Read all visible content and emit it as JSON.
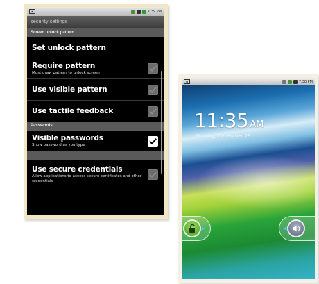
{
  "security_phone": {
    "status_bar": {
      "left_icon": "screen-icon",
      "time": "7:39 PM"
    },
    "title": "security settings",
    "sections": [
      {
        "header": "Screen unlock pattern",
        "items": [
          {
            "title": "Set unlock pattern",
            "summary": "",
            "has_checkbox": false
          },
          {
            "title": "Require pattern",
            "summary": "Must draw pattern to unlock screen",
            "has_checkbox": true,
            "checked": false
          },
          {
            "title": "Use visible pattern",
            "summary": "",
            "has_checkbox": true,
            "checked": false
          },
          {
            "title": "Use tactile feedback",
            "summary": "",
            "has_checkbox": true,
            "checked": false
          }
        ]
      },
      {
        "header": "Passwords",
        "items": [
          {
            "title": "Visible passwords",
            "summary": "Show password as you type",
            "has_checkbox": true,
            "checked": true
          },
          {
            "title": "Use secure credentials",
            "summary": "Allow applications to access secure certificates and other credentials",
            "has_checkbox": true,
            "checked": false
          }
        ]
      }
    ]
  },
  "lock_phone": {
    "status_bar": {
      "left_icon": "screen-icon",
      "time": "7:38 PM"
    },
    "time": "11:35",
    "ampm": "AM",
    "date": "Monday, December 28",
    "unlock_icon": "unlock-icon",
    "sound_icon": "speaker-icon"
  }
}
